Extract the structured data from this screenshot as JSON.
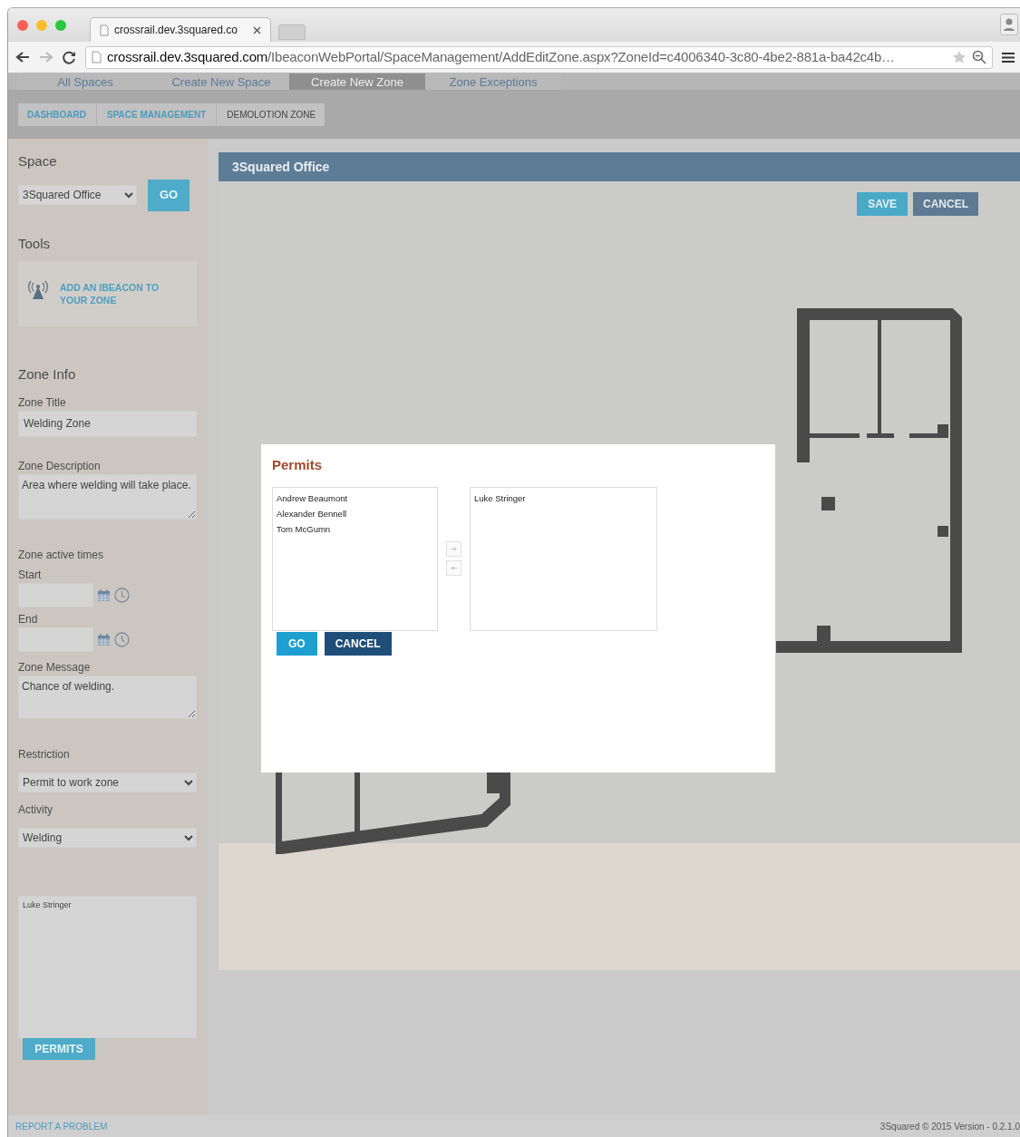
{
  "browser": {
    "tab_title": "crossrail.dev.3squared.co",
    "url_host": "crossrail.dev.3squared.com",
    "url_path": "/IbeaconWebPortal/SpaceManagement/AddEditZone.aspx?ZoneId=c4006340-3c80-4be2-881a-ba42c4b…"
  },
  "nav_tabs": [
    {
      "label": "All Spaces",
      "selected": false
    },
    {
      "label": "Create New Space",
      "selected": false
    },
    {
      "label": "Create New Zone",
      "selected": true
    },
    {
      "label": "Zone Exceptions",
      "selected": false
    }
  ],
  "breadcrumb": [
    {
      "label": "DASHBOARD",
      "kind": "link"
    },
    {
      "label": "SPACE MANAGEMENT",
      "kind": "link"
    },
    {
      "label": "DEMOLOTION ZONE",
      "kind": "current"
    }
  ],
  "sidebar": {
    "space_heading": "Space",
    "space_select": "3Squared Office",
    "go_button": "GO",
    "tools_heading": "Tools",
    "tool_button": "ADD AN IBEACON TO YOUR ZONE",
    "zone_info_heading": "Zone Info",
    "zone_title": {
      "label": "Zone Title",
      "value": "Welding Zone"
    },
    "zone_description": {
      "label": "Zone Description",
      "value": "Area where welding will take place."
    },
    "active_times_label": "Zone active times",
    "start_label": "Start",
    "end_label": "End",
    "zone_message": {
      "label": "Zone Message",
      "value": "Chance of welding."
    },
    "restriction": {
      "label": "Restriction",
      "value": "Permit to work zone"
    },
    "activity": {
      "label": "Activity",
      "value": "Welding"
    },
    "permit_list": [
      "Luke Stringer"
    ],
    "permits_button": "PERMITS"
  },
  "main": {
    "title": "3Squared Office",
    "save_button": "SAVE",
    "cancel_button": "CANCEL"
  },
  "modal": {
    "title": "Permits",
    "available": [
      "Andrew Beaumont",
      "Alexander Bennell",
      "Tom McGumn"
    ],
    "chosen": [
      "Luke Stringer"
    ],
    "go_button": "GO",
    "cancel_button": "CANCEL"
  },
  "footer": {
    "report_link": "REPORT A PROBLEM",
    "version": "3Squared © 2015 Version - 0.2.1.0"
  }
}
